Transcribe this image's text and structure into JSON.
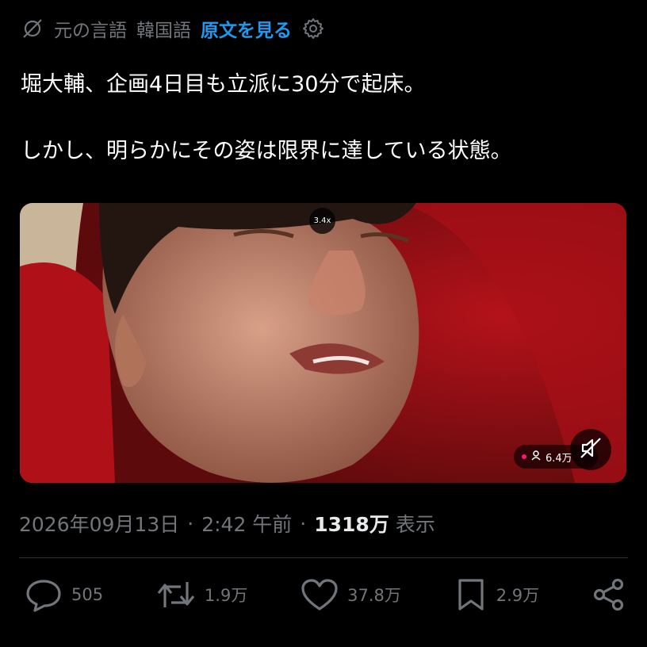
{
  "translation": {
    "original_language": "元の言語",
    "language": "韓国語",
    "show_original": "原文を見る"
  },
  "tweet": {
    "paragraphs": [
      "堀大輔、企画4日目も立派に30分で起床。",
      "しかし、明らかにその姿は限界に達している状態。"
    ]
  },
  "media": {
    "zoom_label": "3.4x",
    "viewers": "6.4万",
    "accent_color": "#c8141c"
  },
  "meta": {
    "date": "2026年09月13日",
    "separator": "·",
    "time": "2:42 午前",
    "views_count": "1318万",
    "views_label": "表示"
  },
  "actions": {
    "reply_count": "505",
    "repost_count": "1.9万",
    "like_count": "37.8万",
    "bookmark_count": "2.9万"
  },
  "colors": {
    "link": "#1d9bf0",
    "muted": "#71767b",
    "background": "#000000"
  }
}
